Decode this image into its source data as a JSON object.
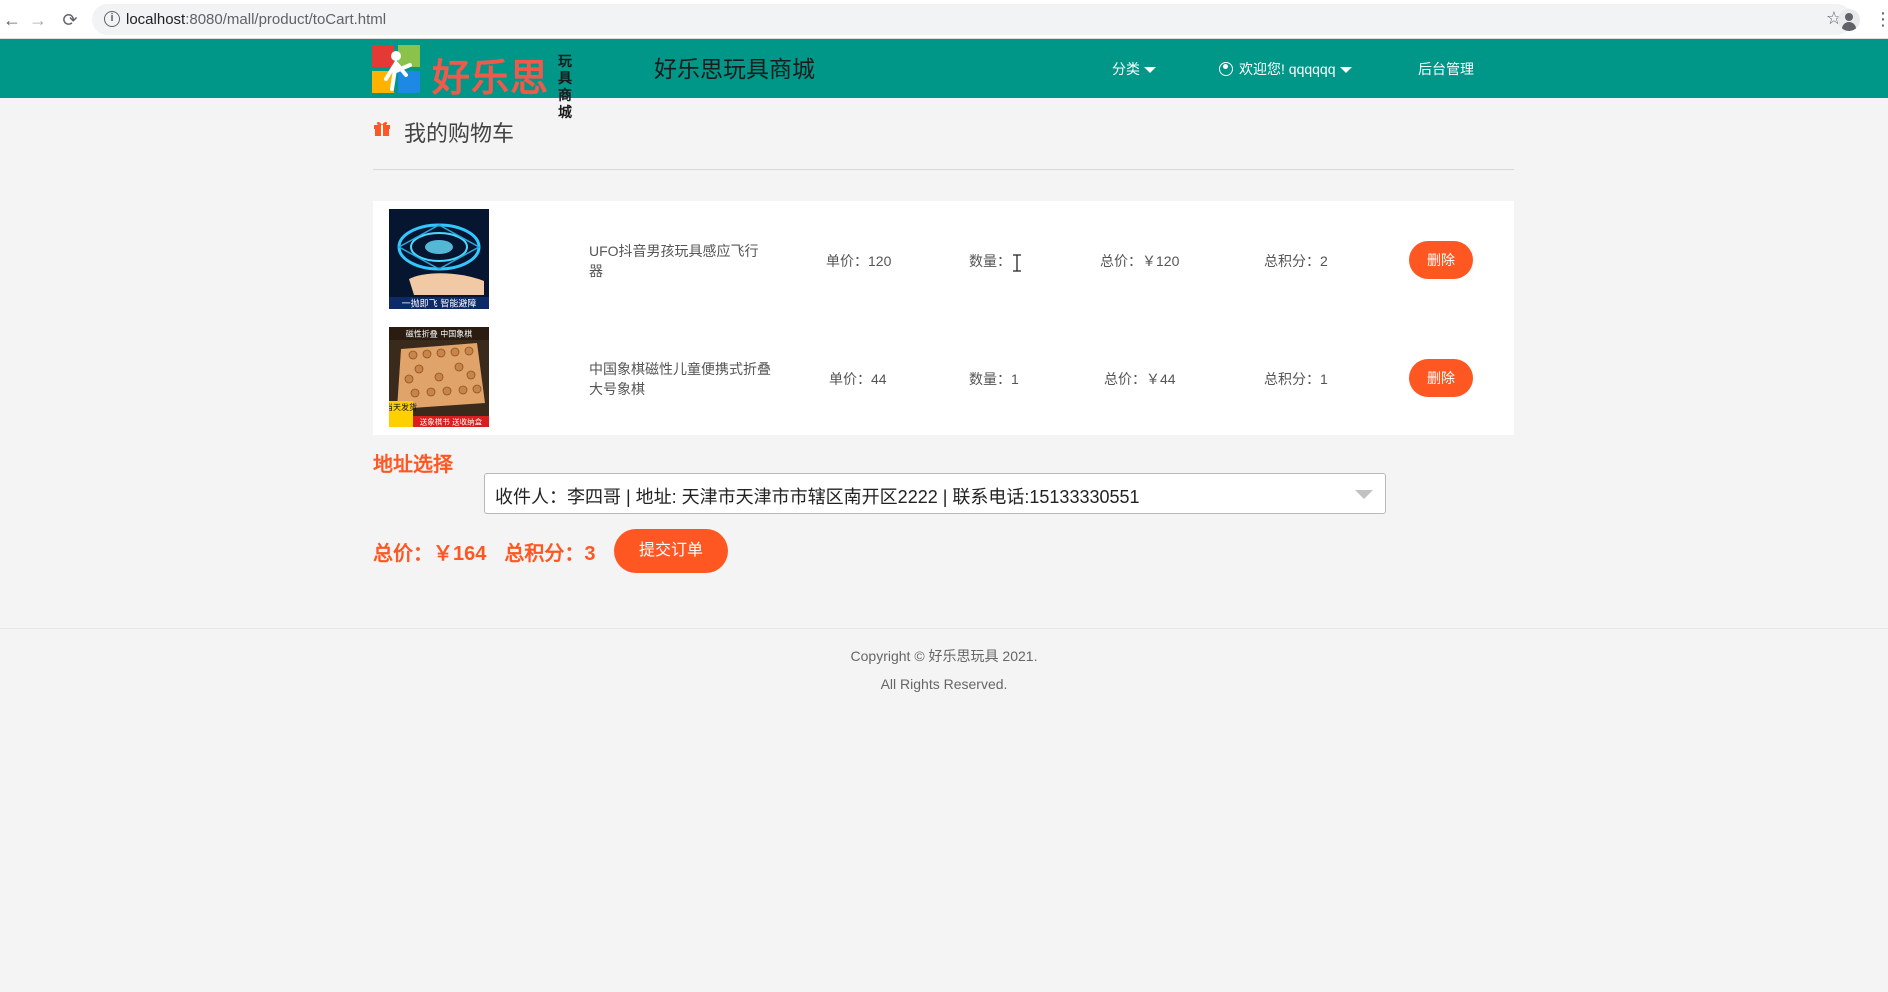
{
  "browser": {
    "url_host": "localhost",
    "url_rest": ":8080/mall/product/toCart.html"
  },
  "header": {
    "logo_text": "好乐思",
    "logo_side": "玩具商城",
    "site_title": "好乐思玩具商城",
    "nav": {
      "category": "分类",
      "welcome": "欢迎您! qqqqqq",
      "admin": "后台管理"
    }
  },
  "page": {
    "title": "我的购物车"
  },
  "cart": {
    "items": [
      {
        "name": "UFO抖音男孩玩具感应飞行器",
        "unit_price": "单价：120",
        "quantity": "数量：",
        "total": "总价：￥120",
        "points": "总积分：2",
        "delete": "删除",
        "thumb_caption": "一抛即飞 智能避障"
      },
      {
        "name": "中国象棋磁性儿童便携式折叠大号象棋",
        "unit_price": "单价：44",
        "quantity": "数量：1",
        "total": "总价：￥44",
        "points": "总积分：1",
        "delete": "删除",
        "thumb_caption_top": "磁性折叠 中国象棋",
        "thumb_caption_left": "当天发货",
        "thumb_caption_bottom": "送象棋书 送收纳盒"
      }
    ]
  },
  "address": {
    "label": "地址选择",
    "selected": "收件人：李四哥 | 地址: 天津市天津市市辖区南开区2222 | 联系电话:15133330551"
  },
  "summary": {
    "total": "总价：￥164",
    "points": "总积分：3",
    "submit": "提交订单"
  },
  "footer": {
    "copyright_prefix": "Copyright © ",
    "brand": "好乐思玩具",
    "copyright_suffix": " 2021.",
    "rights": "All Rights Reserved."
  },
  "colors": {
    "header": "#009688",
    "accent": "#ff5722",
    "background": "#f4f4f4"
  }
}
